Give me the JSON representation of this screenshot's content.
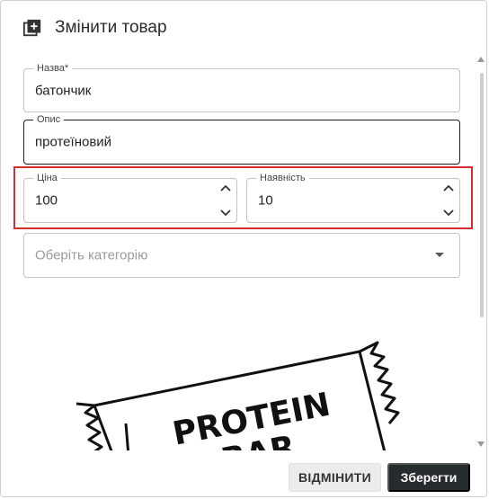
{
  "dialog": {
    "title": "Змінити товар",
    "icon": "add-box-icon"
  },
  "form": {
    "name": {
      "label": "Назва*",
      "value": "батончик"
    },
    "description": {
      "label": "Опис",
      "value": "протеїновий"
    },
    "price": {
      "label": "Ціна",
      "value": "100"
    },
    "stock": {
      "label": "Наявність",
      "value": "10"
    },
    "category": {
      "placeholder": "Оберіть категорію",
      "value": ""
    }
  },
  "image": {
    "text_line1": "PROTEIN",
    "text_line2": "BAR"
  },
  "actions": {
    "cancel_label": "ВІДМІНИТИ",
    "save_label": "Зберегти"
  },
  "colors": {
    "highlight": "#d32f2f",
    "save_button_bg": "#262b2e",
    "cancel_button_bg": "#ececec"
  }
}
